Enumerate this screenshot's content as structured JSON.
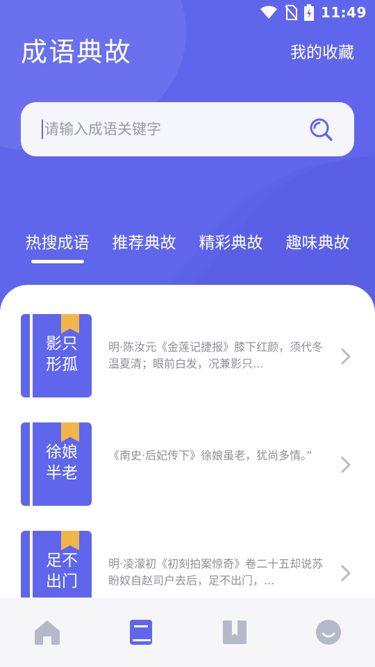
{
  "status": {
    "time": "11:49"
  },
  "header": {
    "title": "成语典故",
    "favorites_label": "我的收藏"
  },
  "search": {
    "placeholder": "请输入成语关键字"
  },
  "tabs": [
    {
      "label": "热搜成语",
      "active": true
    },
    {
      "label": "推荐典故",
      "active": false
    },
    {
      "label": "精彩典故",
      "active": false
    },
    {
      "label": "趣味典故",
      "active": false
    }
  ],
  "idioms": [
    {
      "line1": "影只",
      "line2": "形孤",
      "desc": "明·陈汝元《金莲记捷报》膝下红颜，须代冬温夏清；眼前白发，况兼影只..."
    },
    {
      "line1": "徐娘",
      "line2": "半老",
      "desc": "《南史·后妃传下》徐娘虽老，犹尚多情。”"
    },
    {
      "line1": "足不",
      "line2": "出门",
      "desc": "明·凌濛初《初刻拍案惊奇》卷二十五却说苏盼奴自赵司户去后，足不出门，..."
    }
  ],
  "nav": [
    {
      "icon": "home-icon",
      "active": false
    },
    {
      "icon": "book-icon",
      "active": true
    },
    {
      "icon": "bookmark-book-icon",
      "active": false
    },
    {
      "icon": "smile-icon",
      "active": false
    }
  ],
  "colors": {
    "primary": "#5f66ec",
    "accent": "#f0b64a",
    "inactive": "#b5b9c8"
  }
}
